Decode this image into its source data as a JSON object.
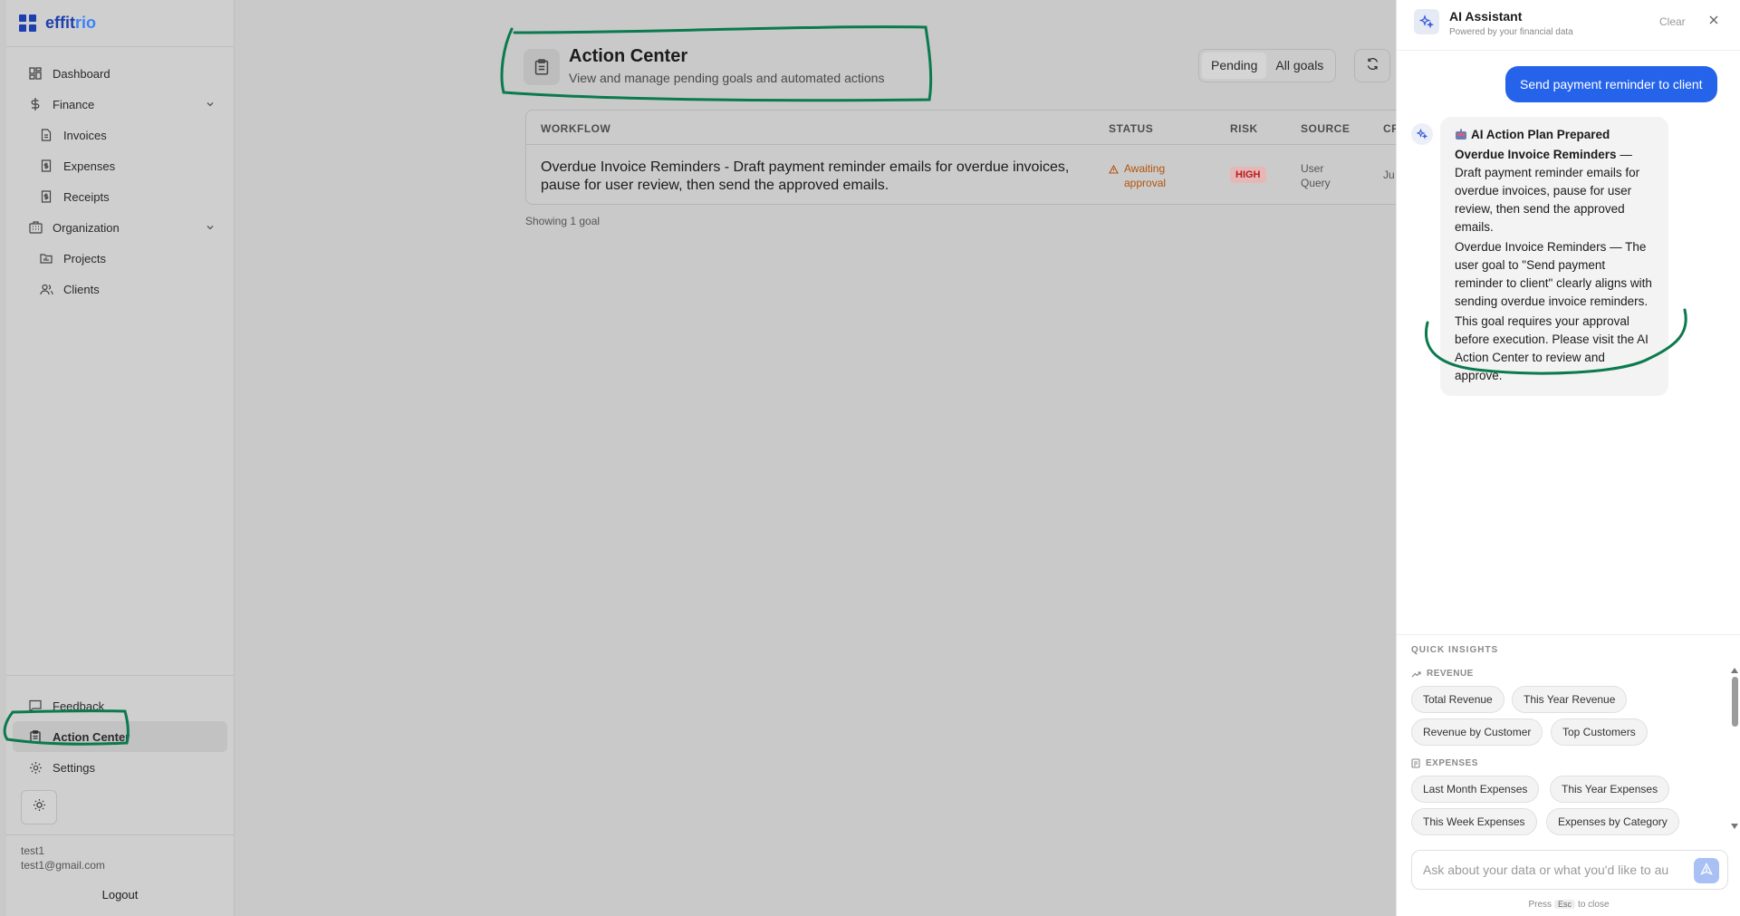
{
  "app": {
    "brand_part1": "effit",
    "brand_part2": "rio"
  },
  "sidebar": {
    "items": [
      {
        "label": "Dashboard"
      },
      {
        "label": "Finance"
      },
      {
        "label": "Invoices"
      },
      {
        "label": "Expenses"
      },
      {
        "label": "Receipts"
      },
      {
        "label": "Organization"
      },
      {
        "label": "Projects"
      },
      {
        "label": "Clients"
      }
    ],
    "bottom": [
      {
        "label": "Feedback"
      },
      {
        "label": "Action Center"
      },
      {
        "label": "Settings"
      }
    ],
    "user": {
      "name": "test1",
      "email": "test1@gmail.com"
    },
    "logout": "Logout"
  },
  "page": {
    "title": "Action Center",
    "subtitle": "View and manage pending goals and automated actions",
    "filters": [
      "Pending",
      "All goals"
    ],
    "table": {
      "headers": [
        "WORKFLOW",
        "STATUS",
        "RISK",
        "SOURCE",
        "CR"
      ],
      "rows": [
        {
          "workflow": "Overdue Invoice Reminders - Draft payment reminder emails for overdue invoices, pause for user review, then send the approved emails.",
          "status_line1": "Awaiting",
          "status_line2": "approval",
          "risk": "HIGH",
          "source_line1": "User",
          "source_line2": "Query",
          "created": "Ju"
        }
      ]
    },
    "footer": "Showing 1 goal"
  },
  "assistant": {
    "title": "AI Assistant",
    "subtitle": "Powered by your financial data",
    "clear": "Clear",
    "user_message": "Send payment reminder to client",
    "bot": {
      "heading": "AI Action Plan Prepared",
      "p1_bold": "Overdue Invoice Reminders",
      "p1_rest": " — Draft payment reminder emails for overdue invoices, pause for user review, then send the approved emails.",
      "p2": "Overdue Invoice Reminders — The user goal to \"Send payment reminder to client\" clearly aligns with sending overdue invoice reminders.",
      "p3": "This goal requires your approval before execution. Please visit the AI Action Center to review and approve."
    },
    "quick_insights": {
      "title": "QUICK INSIGHTS",
      "revenue_label": "REVENUE",
      "revenue_chips": [
        "Total Revenue",
        "This Year Revenue",
        "Revenue by Customer",
        "Top Customers"
      ],
      "expenses_label": "EXPENSES",
      "expenses_chips": [
        "Last Month Expenses",
        "This Year Expenses",
        "This Week Expenses",
        "Expenses by Category"
      ]
    },
    "input_placeholder": "Ask about your data or what you'd like to au",
    "hint_pre": "Press",
    "hint_key": "Esc",
    "hint_post": "to close"
  },
  "colors": {
    "brand": "#1e40af",
    "accent": "#2563eb",
    "annotation": "#0b7a4e",
    "risk_high": "#b91c1c",
    "status_warn": "#b45309"
  }
}
